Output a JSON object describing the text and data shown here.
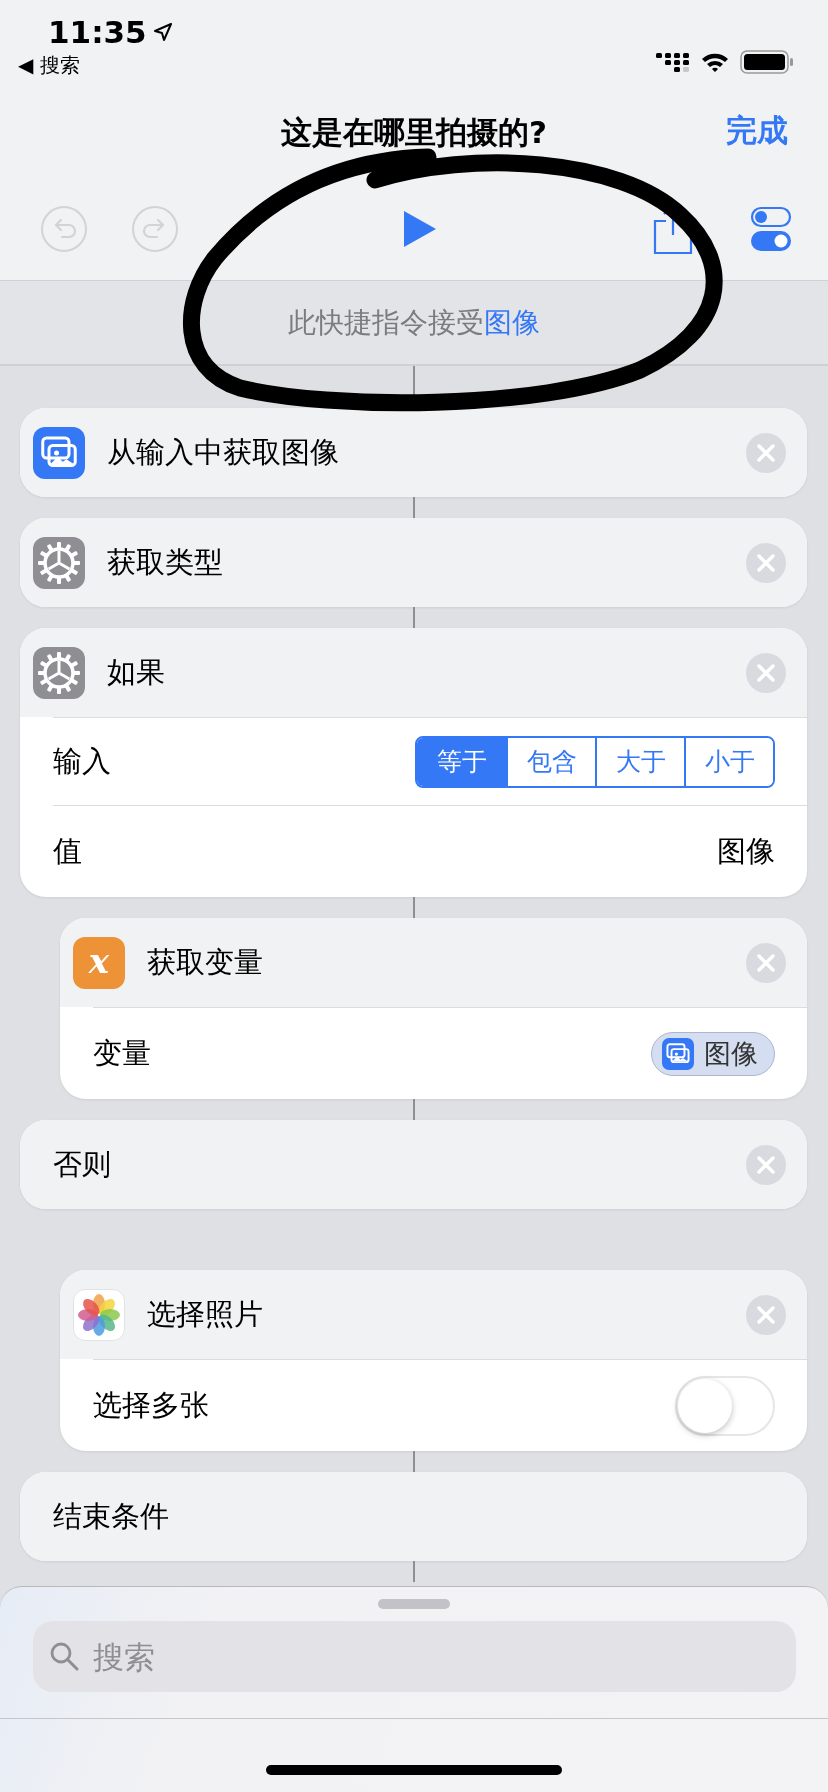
{
  "status_bar": {
    "time": "11:35",
    "back_glyph": "◀",
    "back_label": "搜索"
  },
  "nav": {
    "title": "这是在哪里拍摄的?",
    "done": "完成"
  },
  "toolbar": {
    "undo": {
      "disabled": true
    },
    "redo": {
      "disabled": true
    }
  },
  "banner": {
    "text": "此快捷指令接受",
    "link": "图像"
  },
  "blocks": [
    {
      "title": "从输入中获取图像",
      "kind": "media",
      "removable": true
    },
    {
      "title": "获取类型",
      "kind": "scripting",
      "removable": true
    },
    {
      "title": "如果",
      "kind": "scripting",
      "removable": true,
      "rows": [
        {
          "kind": "segments",
          "label": "输入",
          "segments": [
            {
              "label": "等于",
              "selected": true
            },
            {
              "label": "包含",
              "selected": false
            },
            {
              "label": "大于",
              "selected": false
            },
            {
              "label": "小于",
              "selected": false
            }
          ]
        },
        {
          "kind": "value",
          "label": "值",
          "value": "图像"
        }
      ],
      "children": [
        {
          "title": "获取变量",
          "kind": "variables",
          "glyph": "x",
          "removable": true,
          "rows": [
            {
              "kind": "token",
              "label": "变量",
              "value": "图像"
            }
          ]
        }
      ]
    },
    {
      "title": "否则",
      "removable": true,
      "children": [
        {
          "title": "选择照片",
          "kind": "photos",
          "removable": true,
          "rows": [
            {
              "kind": "switch",
              "label": "选择多张",
              "on": false
            }
          ]
        }
      ]
    },
    {
      "title": "结束条件",
      "removable": false
    }
  ],
  "sheet": {
    "search": {
      "placeholder": "搜索"
    }
  }
}
